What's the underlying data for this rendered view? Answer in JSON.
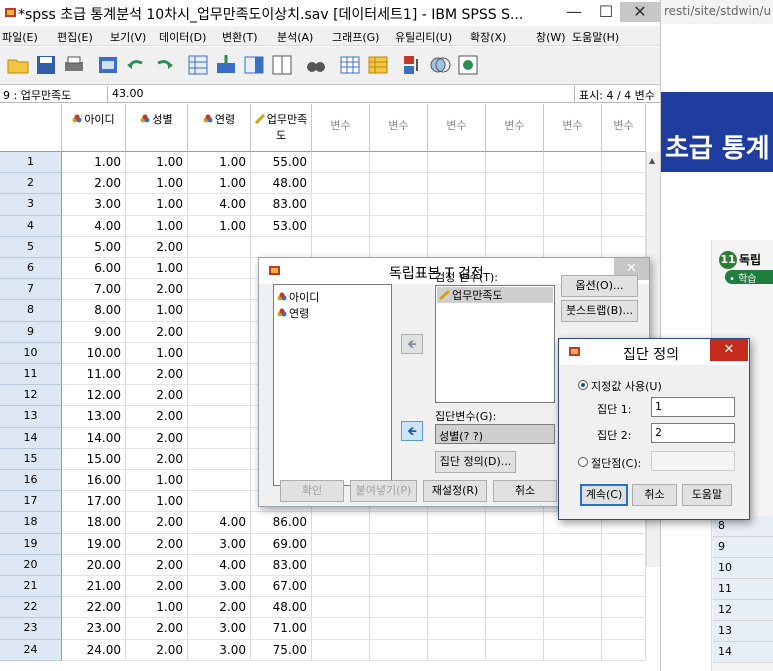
{
  "window": {
    "title": "*spss 초급 통계분석 10차시_업무만족도이상치.sav [데이터세트1] - IBM SPSS S...",
    "minimize": "—",
    "maximize": "☐",
    "close": "✕"
  },
  "menu": [
    "파일(E)",
    "편집(E)",
    "보기(V)",
    "데이터(D)",
    "변환(T)",
    "분석(A)",
    "그래프(G)",
    "유틸리티(U)",
    "확장(X)",
    "창(W)",
    "도움말(H)"
  ],
  "cellbar": {
    "ref": "9 : 업무만족도",
    "value": "43.00",
    "info": "표시: 4 / 4 변수"
  },
  "grid": {
    "columns": [
      "아이디",
      "성별",
      "연령",
      "업무만족도"
    ],
    "empty_column_label": "변수",
    "rows": [
      [
        "1",
        "1.00",
        "1.00",
        "1.00",
        "55.00"
      ],
      [
        "2",
        "2.00",
        "1.00",
        "1.00",
        "48.00"
      ],
      [
        "3",
        "3.00",
        "1.00",
        "4.00",
        "83.00"
      ],
      [
        "4",
        "4.00",
        "1.00",
        "1.00",
        "53.00"
      ],
      [
        "5",
        "5.00",
        "2.00",
        "",
        ""
      ],
      [
        "6",
        "6.00",
        "1.00",
        "",
        ""
      ],
      [
        "7",
        "7.00",
        "2.00",
        "",
        ""
      ],
      [
        "8",
        "8.00",
        "1.00",
        "",
        ""
      ],
      [
        "9",
        "9.00",
        "2.00",
        "",
        ""
      ],
      [
        "10",
        "10.00",
        "1.00",
        "",
        ""
      ],
      [
        "11",
        "11.00",
        "2.00",
        "",
        ""
      ],
      [
        "12",
        "12.00",
        "2.00",
        "",
        ""
      ],
      [
        "13",
        "13.00",
        "2.00",
        "",
        ""
      ],
      [
        "14",
        "14.00",
        "2.00",
        "",
        ""
      ],
      [
        "15",
        "15.00",
        "2.00",
        "",
        ""
      ],
      [
        "16",
        "16.00",
        "1.00",
        "",
        ""
      ],
      [
        "17",
        "17.00",
        "1.00",
        "",
        ""
      ],
      [
        "18",
        "18.00",
        "2.00",
        "4.00",
        "86.00"
      ],
      [
        "19",
        "19.00",
        "2.00",
        "3.00",
        "69.00"
      ],
      [
        "20",
        "20.00",
        "2.00",
        "4.00",
        "83.00"
      ],
      [
        "21",
        "21.00",
        "2.00",
        "3.00",
        "67.00"
      ],
      [
        "22",
        "22.00",
        "1.00",
        "2.00",
        "48.00"
      ],
      [
        "23",
        "23.00",
        "2.00",
        "3.00",
        "71.00"
      ],
      [
        "24",
        "24.00",
        "2.00",
        "3.00",
        "75.00"
      ]
    ]
  },
  "ttest_dialog": {
    "title": "독립표본 T 검정",
    "source_vars": [
      "아이디",
      "연령"
    ],
    "test_var_label": "검정 변수(T):",
    "test_vars": [
      "업무만족도"
    ],
    "group_var_label": "집단변수(G):",
    "group_var": "성별(? ?)",
    "define_groups_button": "집단 정의(D)...",
    "options_button": "옵션(O)...",
    "bootstrap_button": "붓스트랩(B)...",
    "ok_button": "확인",
    "paste_button": "붙여넣기(P)",
    "reset_button": "재설정(R)",
    "cancel_button": "취소",
    "close": "✕"
  },
  "define_dialog": {
    "title": "집단 정의",
    "use_values_label": "지정값 사용(U)",
    "group1_label": "집단 1:",
    "group1_value": "1",
    "group2_label": "집단 2:",
    "group2_value": "2",
    "cutpoint_label": "절단점(C):",
    "continue_button": "계속(C)",
    "cancel_button": "취소",
    "help_button": "도움말",
    "close": "✕"
  },
  "browser": {
    "url": "resti/site/stdwin/u",
    "banner_text": "초급 통계",
    "lesson_number": "11",
    "lesson_heading": "독립",
    "lesson_pill": "• 학습",
    "mini_rows": [
      "8",
      "9",
      "10",
      "11",
      "12",
      "13",
      "14"
    ]
  }
}
